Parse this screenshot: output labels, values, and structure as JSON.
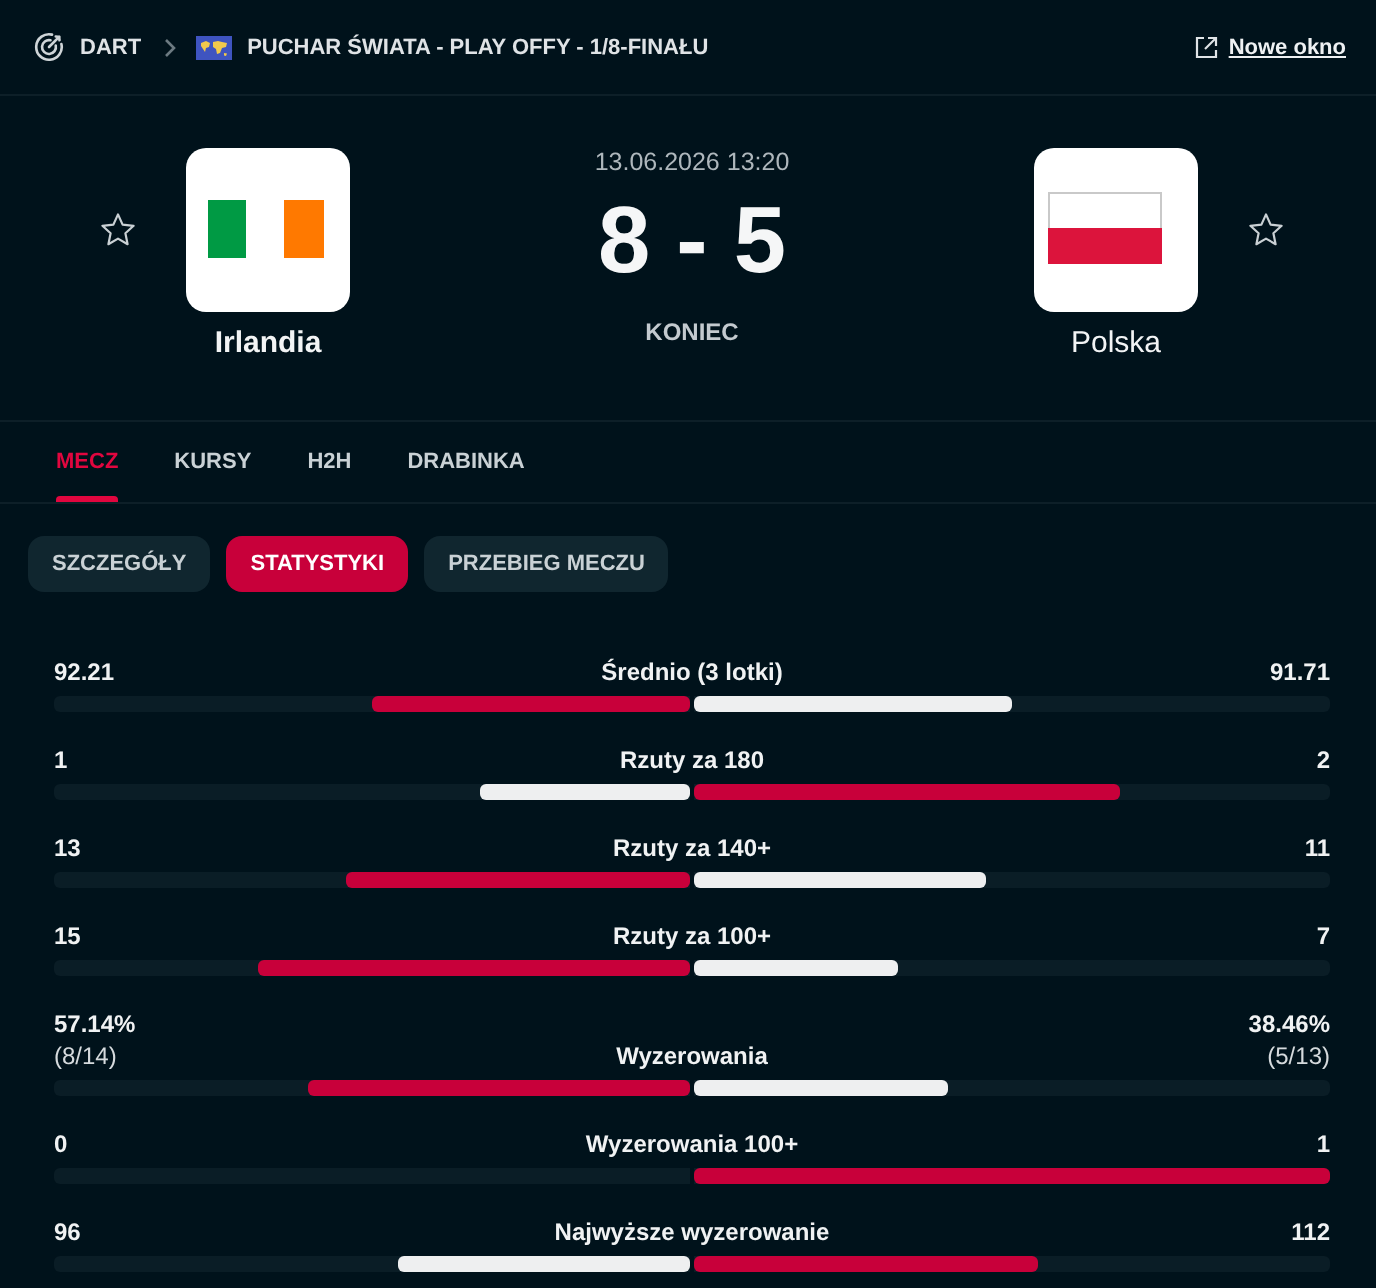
{
  "breadcrumb": {
    "sport": "DART",
    "competition": "PUCHAR ŚWIATA - PLAY OFFY - 1/8-FINAŁU",
    "new_window": "Nowe okno"
  },
  "match": {
    "date": "13.06.2026 13:20",
    "score": "8 - 5",
    "status": "KONIEC",
    "teams": [
      {
        "name": "Irlandia",
        "kind": "ireland",
        "winner": true,
        "favorite": false
      },
      {
        "name": "Polska",
        "kind": "poland",
        "winner": false,
        "favorite": false
      }
    ]
  },
  "tabs": [
    {
      "label": "MECZ",
      "selected": true
    },
    {
      "label": "KURSY",
      "selected": false
    },
    {
      "label": "H2H",
      "selected": false
    },
    {
      "label": "DRABINKA",
      "selected": false
    }
  ],
  "subtabs": [
    {
      "label": "SZCZEGÓŁY",
      "selected": false
    },
    {
      "label": "STATYSTYKI",
      "selected": true
    },
    {
      "label": "PRZEBIEG MECZU",
      "selected": false
    }
  ],
  "stats": [
    {
      "label": "Średnio (3 lotki)",
      "home": {
        "value": "92.21",
        "level": 0.5,
        "color": "#c8003a"
      },
      "away": {
        "value": "91.71",
        "level": 0.5,
        "color": "#eeeff0"
      }
    },
    {
      "label": "Rzuty za 180",
      "home": {
        "value": "1",
        "level": 0.33,
        "color": "#eeeff0"
      },
      "away": {
        "value": "2",
        "level": 0.67,
        "color": "#c8003a"
      }
    },
    {
      "label": "Rzuty za 140+",
      "home": {
        "value": "13",
        "level": 0.54,
        "color": "#c8003a"
      },
      "away": {
        "value": "11",
        "level": 0.46,
        "color": "#eeeff0"
      }
    },
    {
      "label": "Rzuty za 100+",
      "home": {
        "value": "15",
        "level": 0.68,
        "color": "#c8003a"
      },
      "away": {
        "value": "7",
        "level": 0.32,
        "color": "#eeeff0"
      }
    },
    {
      "label": "Wyzerowania",
      "home": {
        "value": "57.14%",
        "detail": "(8/14)",
        "level": 0.6,
        "color": "#c8003a"
      },
      "away": {
        "value": "38.46%",
        "detail": "(5/13)",
        "level": 0.4,
        "color": "#eeeff0"
      }
    },
    {
      "label": "Wyzerowania 100+",
      "home": {
        "value": "0",
        "level": 0
      },
      "away": {
        "value": "1",
        "level": 1,
        "color": "#c8003a"
      }
    },
    {
      "label": "Najwyższe wyzerowanie",
      "home": {
        "value": "96",
        "level": 0.46,
        "color": "#eeeff0"
      },
      "away": {
        "value": "112",
        "level": 0.54,
        "color": "#c8003a"
      }
    }
  ]
}
